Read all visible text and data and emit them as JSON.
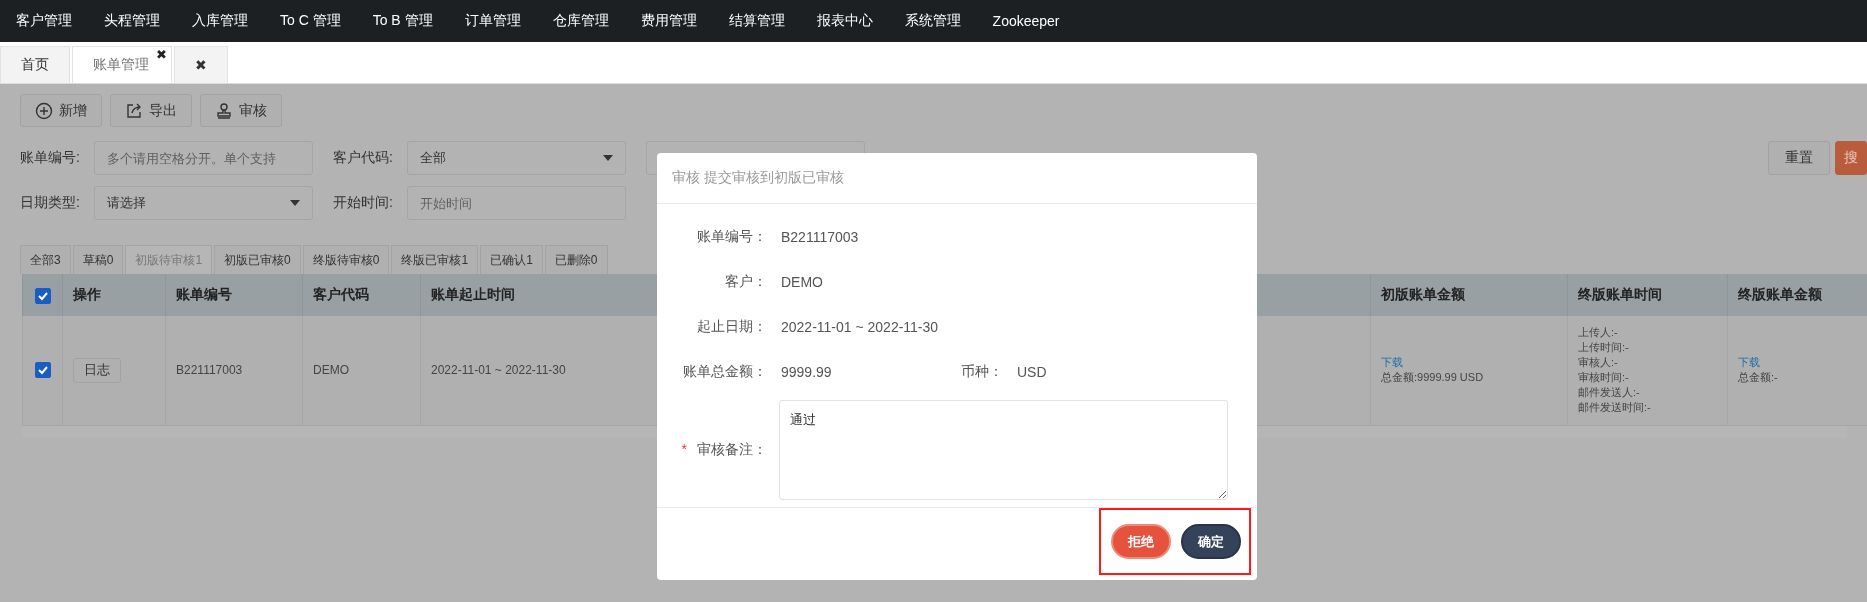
{
  "top_nav": {
    "items": [
      "客户管理",
      "头程管理",
      "入库管理",
      "To C 管理",
      "To B 管理",
      "订单管理",
      "仓库管理",
      "费用管理",
      "结算管理",
      "报表中心",
      "系统管理",
      "Zookeeper"
    ]
  },
  "page_tabs": [
    {
      "label": "首页",
      "selected": false
    },
    {
      "label": "账单管理",
      "selected": true,
      "close": "✖"
    },
    {
      "label": "✖",
      "selected": false
    }
  ],
  "toolbar": [
    {
      "label": "新增",
      "kind": "add"
    },
    {
      "label": "导出",
      "kind": "export"
    },
    {
      "label": "审核",
      "kind": "review"
    }
  ],
  "filters": [
    [
      {
        "label": "账单编号:",
        "kind": "input",
        "placeholder": "多个请用空格分开。单个支持"
      },
      {
        "label": "客户代码:",
        "kind": "select",
        "value": "全部"
      },
      {
        "kind": "input"
      }
    ],
    [
      {
        "label": "日期类型:",
        "kind": "select",
        "value": "请选择"
      },
      {
        "label": "开始时间:",
        "kind": "input",
        "placeholder": "开始时间"
      }
    ]
  ],
  "search_buttons": [
    {
      "label": "重置",
      "kind": "default"
    },
    {
      "label": "搜",
      "kind": "primary"
    }
  ],
  "status_tabs": [
    {
      "label": "全部3",
      "selected": false
    },
    {
      "label": "草稿0",
      "selected": false
    },
    {
      "label": "初版待审核1",
      "selected": true
    },
    {
      "label": "初版已审核0",
      "selected": false
    },
    {
      "label": "终版待审核0",
      "selected": false
    },
    {
      "label": "终版已审核1",
      "selected": false
    },
    {
      "label": "已确认1",
      "selected": false
    },
    {
      "label": "已删除0",
      "selected": false
    }
  ],
  "table": {
    "all_checked": true,
    "columns": [
      "操作",
      "账单编号",
      "客户代码",
      "账单起止时间",
      "初版账单金额",
      "终版账单时间",
      "终版账单金额"
    ],
    "rows": [
      {
        "checked": true,
        "action": "日志",
        "bill_no": "B221117003",
        "customer": "DEMO",
        "period": "2022-11-01 ~ 2022-11-30",
        "initial_amount": {
          "link": "下载",
          "total": "总金额:9999.99 USD"
        },
        "final_time": [
          "上传人:-",
          "上传时间:-",
          "审核人:-",
          "审核时间:-",
          "邮件发送人:-",
          "邮件发送时间:-"
        ],
        "final_amount": {
          "link": "下载",
          "total": "总金额:-"
        }
      }
    ]
  },
  "dialog": {
    "title": "审核 提交审核到初版已审核",
    "fields": [
      {
        "label": "账单编号：",
        "value": "B221117003"
      },
      {
        "label": "客户：",
        "value": "DEMO"
      },
      {
        "label": "起止日期：",
        "value": "2022-11-01 ~ 2022-11-30"
      }
    ],
    "amount": {
      "label": "账单总金额：",
      "value": "9999.99",
      "currency_label": "币种：",
      "currency": "USD"
    },
    "remark": {
      "label": "审核备注：",
      "required_mark": "*",
      "value": "通过"
    },
    "buttons": [
      {
        "label": "拒绝",
        "kind": "danger"
      },
      {
        "label": "确定",
        "kind": "confirm"
      }
    ],
    "buttons_highlighted": true
  }
}
